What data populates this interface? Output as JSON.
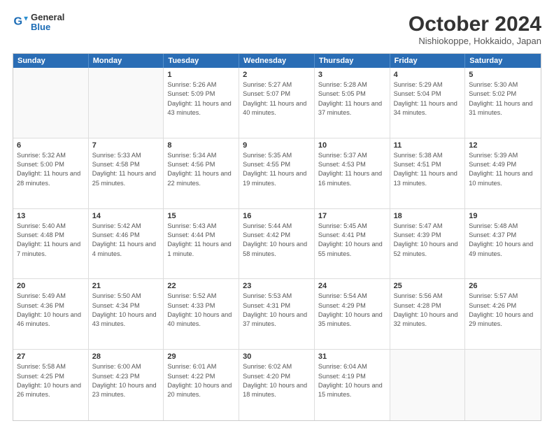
{
  "header": {
    "logo_general": "General",
    "logo_blue": "Blue",
    "month_title": "October 2024",
    "location": "Nishiokoppe, Hokkaido, Japan"
  },
  "weekdays": [
    "Sunday",
    "Monday",
    "Tuesday",
    "Wednesday",
    "Thursday",
    "Friday",
    "Saturday"
  ],
  "rows": [
    [
      {
        "day": "",
        "info": ""
      },
      {
        "day": "",
        "info": ""
      },
      {
        "day": "1",
        "sunrise": "Sunrise: 5:26 AM",
        "sunset": "Sunset: 5:09 PM",
        "daylight": "Daylight: 11 hours and 43 minutes."
      },
      {
        "day": "2",
        "sunrise": "Sunrise: 5:27 AM",
        "sunset": "Sunset: 5:07 PM",
        "daylight": "Daylight: 11 hours and 40 minutes."
      },
      {
        "day": "3",
        "sunrise": "Sunrise: 5:28 AM",
        "sunset": "Sunset: 5:05 PM",
        "daylight": "Daylight: 11 hours and 37 minutes."
      },
      {
        "day": "4",
        "sunrise": "Sunrise: 5:29 AM",
        "sunset": "Sunset: 5:04 PM",
        "daylight": "Daylight: 11 hours and 34 minutes."
      },
      {
        "day": "5",
        "sunrise": "Sunrise: 5:30 AM",
        "sunset": "Sunset: 5:02 PM",
        "daylight": "Daylight: 11 hours and 31 minutes."
      }
    ],
    [
      {
        "day": "6",
        "sunrise": "Sunrise: 5:32 AM",
        "sunset": "Sunset: 5:00 PM",
        "daylight": "Daylight: 11 hours and 28 minutes."
      },
      {
        "day": "7",
        "sunrise": "Sunrise: 5:33 AM",
        "sunset": "Sunset: 4:58 PM",
        "daylight": "Daylight: 11 hours and 25 minutes."
      },
      {
        "day": "8",
        "sunrise": "Sunrise: 5:34 AM",
        "sunset": "Sunset: 4:56 PM",
        "daylight": "Daylight: 11 hours and 22 minutes."
      },
      {
        "day": "9",
        "sunrise": "Sunrise: 5:35 AM",
        "sunset": "Sunset: 4:55 PM",
        "daylight": "Daylight: 11 hours and 19 minutes."
      },
      {
        "day": "10",
        "sunrise": "Sunrise: 5:37 AM",
        "sunset": "Sunset: 4:53 PM",
        "daylight": "Daylight: 11 hours and 16 minutes."
      },
      {
        "day": "11",
        "sunrise": "Sunrise: 5:38 AM",
        "sunset": "Sunset: 4:51 PM",
        "daylight": "Daylight: 11 hours and 13 minutes."
      },
      {
        "day": "12",
        "sunrise": "Sunrise: 5:39 AM",
        "sunset": "Sunset: 4:49 PM",
        "daylight": "Daylight: 11 hours and 10 minutes."
      }
    ],
    [
      {
        "day": "13",
        "sunrise": "Sunrise: 5:40 AM",
        "sunset": "Sunset: 4:48 PM",
        "daylight": "Daylight: 11 hours and 7 minutes."
      },
      {
        "day": "14",
        "sunrise": "Sunrise: 5:42 AM",
        "sunset": "Sunset: 4:46 PM",
        "daylight": "Daylight: 11 hours and 4 minutes."
      },
      {
        "day": "15",
        "sunrise": "Sunrise: 5:43 AM",
        "sunset": "Sunset: 4:44 PM",
        "daylight": "Daylight: 11 hours and 1 minute."
      },
      {
        "day": "16",
        "sunrise": "Sunrise: 5:44 AM",
        "sunset": "Sunset: 4:42 PM",
        "daylight": "Daylight: 10 hours and 58 minutes."
      },
      {
        "day": "17",
        "sunrise": "Sunrise: 5:45 AM",
        "sunset": "Sunset: 4:41 PM",
        "daylight": "Daylight: 10 hours and 55 minutes."
      },
      {
        "day": "18",
        "sunrise": "Sunrise: 5:47 AM",
        "sunset": "Sunset: 4:39 PM",
        "daylight": "Daylight: 10 hours and 52 minutes."
      },
      {
        "day": "19",
        "sunrise": "Sunrise: 5:48 AM",
        "sunset": "Sunset: 4:37 PM",
        "daylight": "Daylight: 10 hours and 49 minutes."
      }
    ],
    [
      {
        "day": "20",
        "sunrise": "Sunrise: 5:49 AM",
        "sunset": "Sunset: 4:36 PM",
        "daylight": "Daylight: 10 hours and 46 minutes."
      },
      {
        "day": "21",
        "sunrise": "Sunrise: 5:50 AM",
        "sunset": "Sunset: 4:34 PM",
        "daylight": "Daylight: 10 hours and 43 minutes."
      },
      {
        "day": "22",
        "sunrise": "Sunrise: 5:52 AM",
        "sunset": "Sunset: 4:33 PM",
        "daylight": "Daylight: 10 hours and 40 minutes."
      },
      {
        "day": "23",
        "sunrise": "Sunrise: 5:53 AM",
        "sunset": "Sunset: 4:31 PM",
        "daylight": "Daylight: 10 hours and 37 minutes."
      },
      {
        "day": "24",
        "sunrise": "Sunrise: 5:54 AM",
        "sunset": "Sunset: 4:29 PM",
        "daylight": "Daylight: 10 hours and 35 minutes."
      },
      {
        "day": "25",
        "sunrise": "Sunrise: 5:56 AM",
        "sunset": "Sunset: 4:28 PM",
        "daylight": "Daylight: 10 hours and 32 minutes."
      },
      {
        "day": "26",
        "sunrise": "Sunrise: 5:57 AM",
        "sunset": "Sunset: 4:26 PM",
        "daylight": "Daylight: 10 hours and 29 minutes."
      }
    ],
    [
      {
        "day": "27",
        "sunrise": "Sunrise: 5:58 AM",
        "sunset": "Sunset: 4:25 PM",
        "daylight": "Daylight: 10 hours and 26 minutes."
      },
      {
        "day": "28",
        "sunrise": "Sunrise: 6:00 AM",
        "sunset": "Sunset: 4:23 PM",
        "daylight": "Daylight: 10 hours and 23 minutes."
      },
      {
        "day": "29",
        "sunrise": "Sunrise: 6:01 AM",
        "sunset": "Sunset: 4:22 PM",
        "daylight": "Daylight: 10 hours and 20 minutes."
      },
      {
        "day": "30",
        "sunrise": "Sunrise: 6:02 AM",
        "sunset": "Sunset: 4:20 PM",
        "daylight": "Daylight: 10 hours and 18 minutes."
      },
      {
        "day": "31",
        "sunrise": "Sunrise: 6:04 AM",
        "sunset": "Sunset: 4:19 PM",
        "daylight": "Daylight: 10 hours and 15 minutes."
      },
      {
        "day": "",
        "info": ""
      },
      {
        "day": "",
        "info": ""
      }
    ]
  ]
}
